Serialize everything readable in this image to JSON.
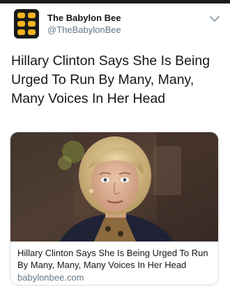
{
  "account": {
    "display_name": "The Babylon Bee",
    "handle": "@TheBabylonBee",
    "logo_icon": "babylon-bee-logo",
    "logo_color": "#f2b51e"
  },
  "tweet": {
    "text": "Hillary Clinton Says She Is Being Urged To Run By Many, Many, Many Voices In Her Head"
  },
  "card": {
    "image_icon": "photo-of-woman-interview",
    "title": "Hillary Clinton Says She Is Being Urged To Run By Many, Many, Many Voices In Her Head",
    "domain": "babylonbee.com"
  },
  "menu_icon": "chevron-down-icon"
}
